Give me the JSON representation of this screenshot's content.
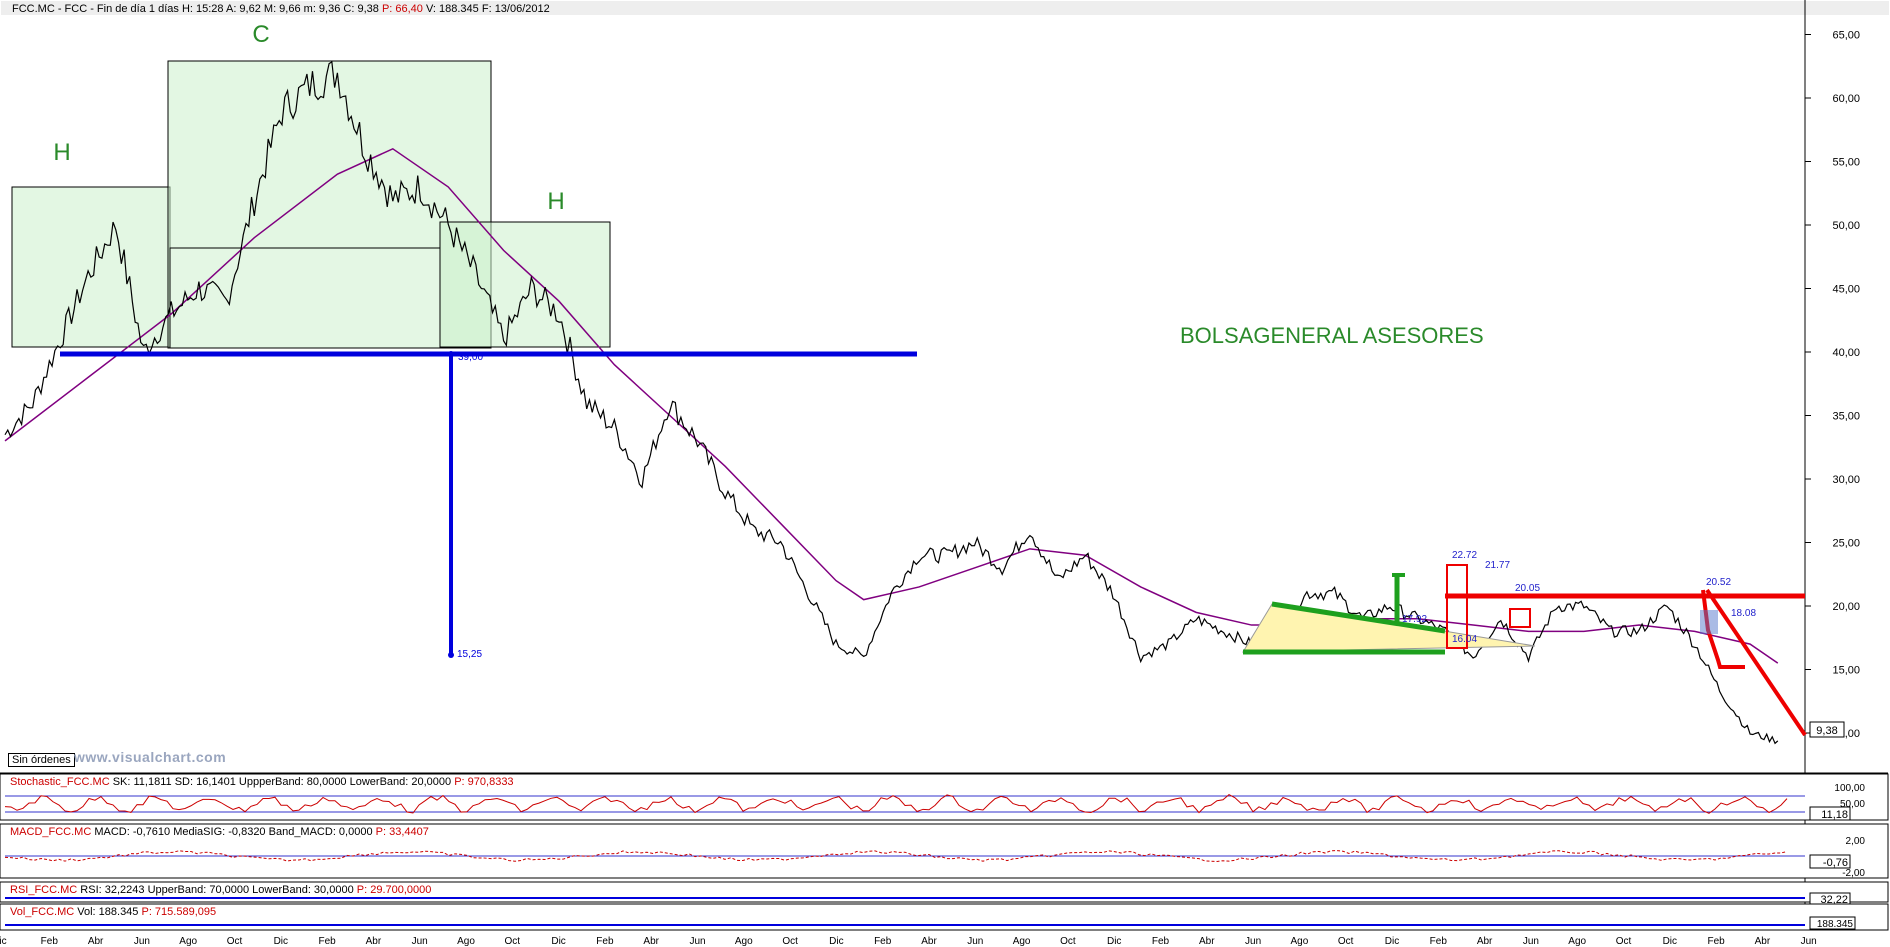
{
  "header": {
    "symbol": "FCC.MC - FCC - Fin de día 1 días",
    "high": "H: 15:28",
    "open": "A: 9,62",
    "max": "M: 9,66",
    "min": "m: 9,36",
    "close": "C: 9,38",
    "p": "P: 66,40",
    "vol": "V: 188.345",
    "date": "F: 13/06/2012"
  },
  "watermark_title": "BOLSAGENERAL ASESORES",
  "pattern_labels": {
    "h1": "H",
    "c": "C",
    "h2": "H"
  },
  "projection": {
    "neck": "39,00",
    "target": "15,25"
  },
  "small_labels": [
    "22.72",
    "21.77",
    "20.05",
    "17.92",
    "16.04",
    "20.52",
    "18.08"
  ],
  "orders_label": "Sin órdenes",
  "site_watermark": "www.visualchart.com",
  "indicators": {
    "stoch": {
      "label": "Stochastic_FCC.MC",
      "sk": "SK: 11,1811",
      "sd": "SD: 16,1401",
      "upper": "UppperBand: 80,0000",
      "lower": "LowerBand: 20,0000",
      "p": "P: 970,8333",
      "value": "11,18",
      "ticks": [
        "100,00",
        "50,00"
      ]
    },
    "macd": {
      "label": "MACD_FCC.MC",
      "macd": "MACD: -0,7610",
      "sig": "MediaSIG: -0,8320",
      "band": "Band_MACD: 0,0000",
      "p": "P: 33,4407",
      "value": "-0,76",
      "ticks": [
        "2,00",
        "-2,00"
      ]
    },
    "rsi": {
      "label": "RSI_FCC.MC",
      "rsi": "RSI: 32,2243",
      "upper": "UpperBand: 70,0000",
      "lower": "LowerBand: 30,0000",
      "p": "P: 29.700,0000",
      "value": "32,22"
    },
    "vol": {
      "label": "Vol_FCC.MC",
      "vol": "Vol: 188.345",
      "p": "P: 715.589,095",
      "value": "188.345"
    }
  },
  "chart_data": {
    "type": "line",
    "title": "FCC.MC - FCC - Fin de día 1 días",
    "ylim": [
      5,
      65
    ],
    "y_ticks": [
      "65,00",
      "60,00",
      "55,00",
      "50,00",
      "45,00",
      "40,00",
      "35,00",
      "30,00",
      "25,00",
      "20,00",
      "15,00",
      "10,00"
    ],
    "last_price": "9,38",
    "x_labels": [
      "ic",
      "Feb",
      "Abr",
      "Jun",
      "Ago",
      "Oct",
      "Dic",
      "Feb",
      "Abr",
      "Jun",
      "Ago",
      "Oct",
      "Dic",
      "Feb",
      "Abr",
      "Jun",
      "Ago",
      "Oct",
      "Dic",
      "Feb",
      "Abr",
      "Jun",
      "Ago",
      "Oct",
      "Dic",
      "Feb",
      "Abr",
      "Jun",
      "Ago",
      "Oct",
      "Dic",
      "Feb",
      "Abr",
      "Jun",
      "Ago",
      "Oct",
      "Dic",
      "Feb",
      "Abr",
      "Jun"
    ],
    "price": [
      [
        0,
        33.5
      ],
      [
        1,
        36
      ],
      [
        2,
        41
      ],
      [
        3,
        46
      ],
      [
        4,
        50
      ],
      [
        5,
        40
      ],
      [
        6,
        43
      ],
      [
        7,
        45
      ],
      [
        8,
        44
      ],
      [
        9,
        52
      ],
      [
        10,
        59
      ],
      [
        11,
        61
      ],
      [
        12,
        62
      ],
      [
        13,
        56
      ],
      [
        14,
        52
      ],
      [
        15,
        53
      ],
      [
        16,
        50
      ],
      [
        17,
        46
      ],
      [
        18,
        41
      ],
      [
        19,
        45
      ],
      [
        20,
        43
      ],
      [
        21,
        36
      ],
      [
        22,
        34
      ],
      [
        23,
        30
      ],
      [
        24,
        36
      ],
      [
        25,
        33
      ],
      [
        26,
        29
      ],
      [
        27,
        26
      ],
      [
        28,
        25
      ],
      [
        29,
        21
      ],
      [
        30,
        17
      ],
      [
        31,
        16
      ],
      [
        32,
        21
      ],
      [
        33,
        24
      ],
      [
        34,
        24
      ],
      [
        35,
        25
      ],
      [
        36,
        23
      ],
      [
        37,
        26
      ],
      [
        38,
        22
      ],
      [
        39,
        24
      ],
      [
        40,
        21
      ],
      [
        41,
        16
      ],
      [
        42,
        17
      ],
      [
        43,
        19
      ],
      [
        44,
        18
      ],
      [
        45,
        17
      ],
      [
        46,
        18
      ],
      [
        47,
        21
      ],
      [
        48,
        21
      ],
      [
        49,
        19
      ],
      [
        50,
        20
      ],
      [
        51,
        19
      ],
      [
        52,
        18
      ],
      [
        53,
        16
      ],
      [
        54,
        19
      ],
      [
        55,
        16
      ],
      [
        56,
        20
      ],
      [
        57,
        20
      ],
      [
        58,
        18
      ],
      [
        59,
        18
      ],
      [
        60,
        20
      ],
      [
        61,
        17
      ],
      [
        62,
        13
      ],
      [
        63,
        10
      ],
      [
        64,
        9.38
      ]
    ],
    "ma": [
      [
        0,
        33
      ],
      [
        3,
        38
      ],
      [
        6,
        43
      ],
      [
        9,
        49
      ],
      [
        12,
        54
      ],
      [
        14,
        56
      ],
      [
        16,
        53
      ],
      [
        18,
        48
      ],
      [
        20,
        44
      ],
      [
        22,
        39
      ],
      [
        24,
        35
      ],
      [
        26,
        31
      ],
      [
        28,
        26.5
      ],
      [
        30,
        22
      ],
      [
        31,
        20.5
      ],
      [
        33,
        21.5
      ],
      [
        35,
        23
      ],
      [
        37,
        24.5
      ],
      [
        39,
        24
      ],
      [
        41,
        21.5
      ],
      [
        43,
        19.5
      ],
      [
        45,
        18.5
      ],
      [
        47,
        18.5
      ],
      [
        49,
        19
      ],
      [
        51,
        19
      ],
      [
        53,
        18.5
      ],
      [
        55,
        18
      ],
      [
        57,
        18
      ],
      [
        59,
        18.5
      ],
      [
        61,
        18
      ],
      [
        63,
        17
      ],
      [
        64,
        15.5
      ]
    ]
  }
}
